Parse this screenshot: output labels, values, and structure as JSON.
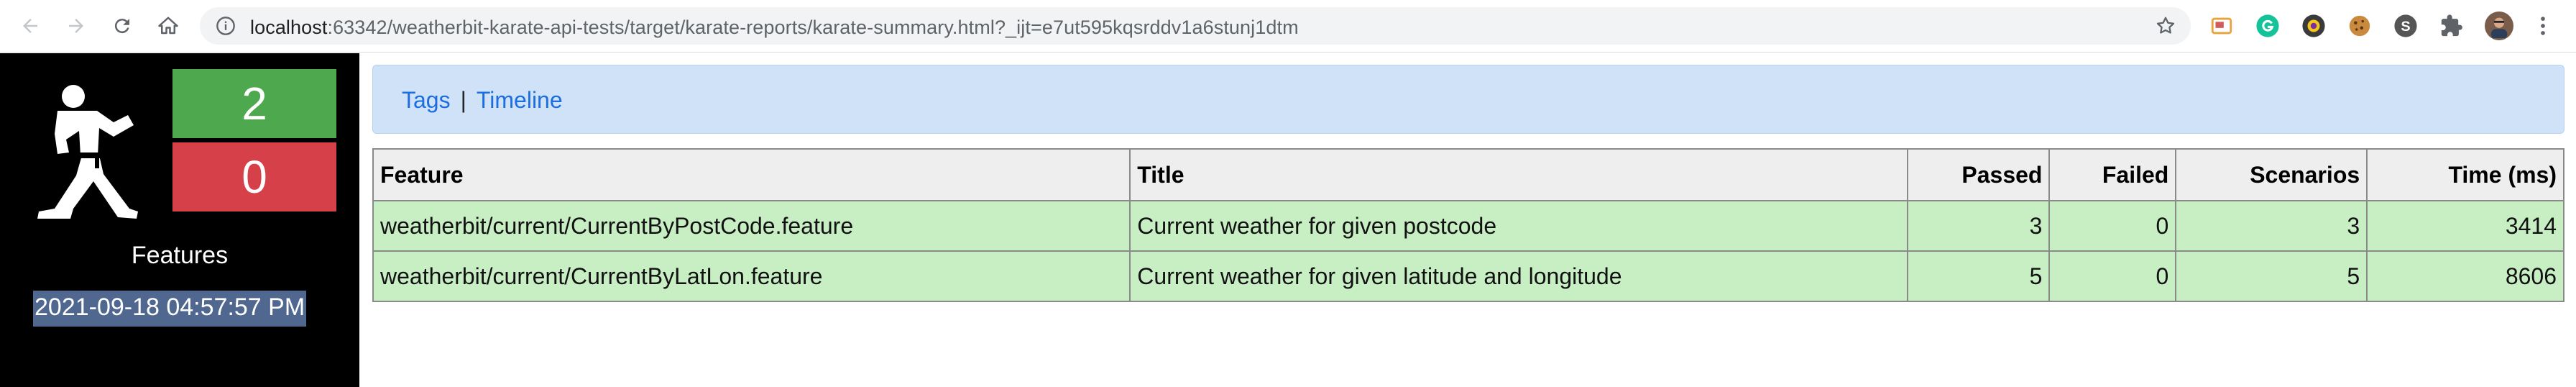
{
  "browser": {
    "url_host": "localhost",
    "url_rest": ":63342/weatherbit-karate-api-tests/target/karate-reports/karate-summary.html?_ijt=e7ut595kqsrddv1a6stunj1dtm",
    "icons": [
      "back-icon",
      "forward-icon",
      "reload-icon",
      "home-icon",
      "info-icon",
      "star-icon",
      "cast-icon",
      "grammarly-icon",
      "camera-extension-icon",
      "cookie-icon",
      "s-extension-icon",
      "puzzle-icon",
      "avatar",
      "kebab-menu-icon"
    ]
  },
  "sidebar": {
    "passed_count": "2",
    "failed_count": "0",
    "features_label": "Features",
    "timestamp": "2021-09-18 04:57:57 PM"
  },
  "nav": {
    "tags": "Tags",
    "separator": "|",
    "timeline": "Timeline"
  },
  "table": {
    "headers": {
      "feature": "Feature",
      "title": "Title",
      "passed": "Passed",
      "failed": "Failed",
      "scenarios": "Scenarios",
      "time": "Time (ms)"
    },
    "rows": [
      {
        "feature": "weatherbit/current/CurrentByPostCode.feature",
        "title": "Current weather for given postcode",
        "passed": "3",
        "failed": "0",
        "scenarios": "3",
        "time": "3414"
      },
      {
        "feature": "weatherbit/current/CurrentByLatLon.feature",
        "title": "Current weather for given latitude and longitude",
        "passed": "5",
        "failed": "0",
        "scenarios": "5",
        "time": "8606"
      }
    ]
  },
  "colors": {
    "pass": "#4ea84e",
    "fail": "#d64048",
    "row_pass": "#c8eec4",
    "link": "#1c6ee0"
  }
}
